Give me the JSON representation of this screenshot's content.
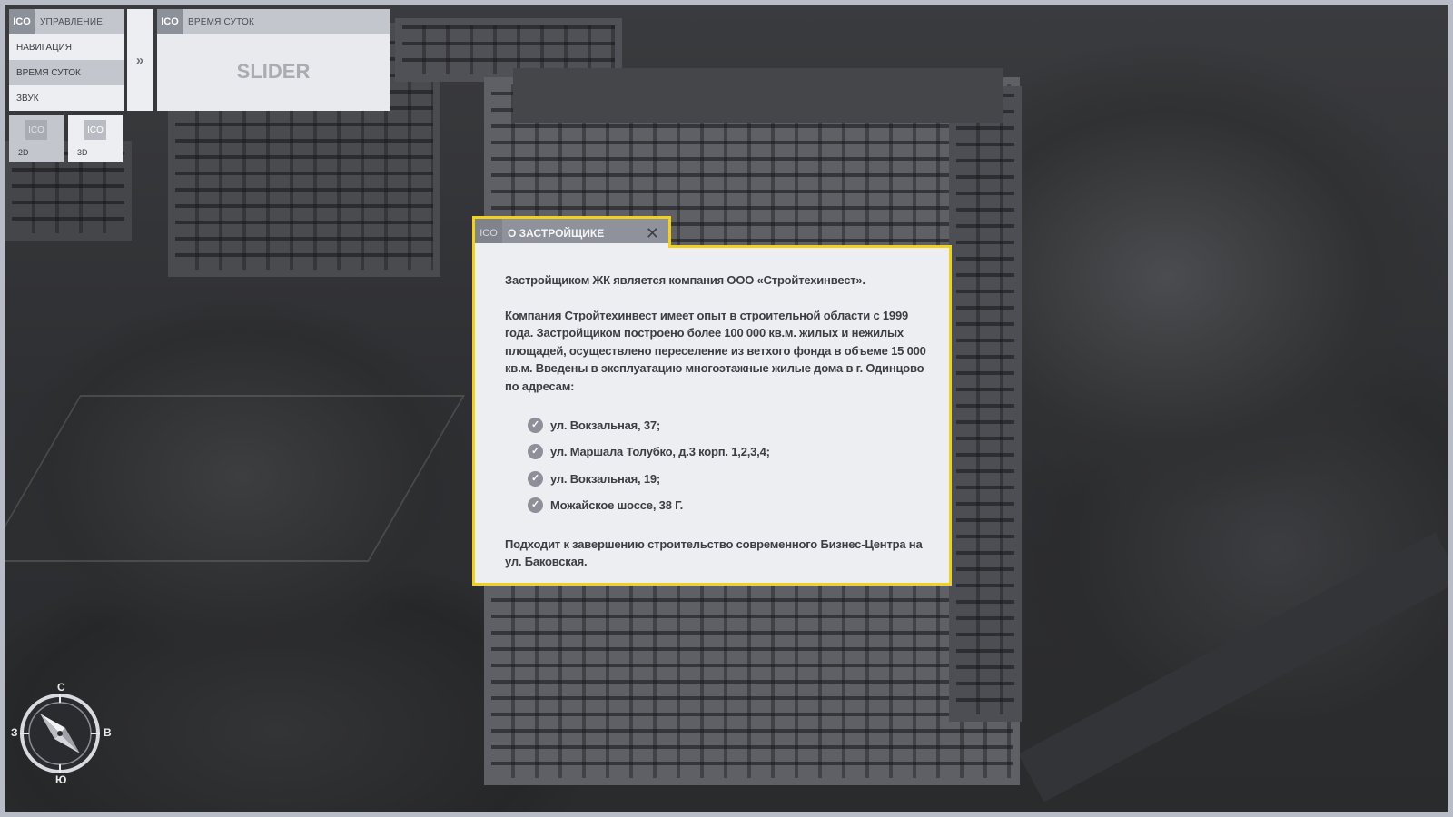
{
  "controls": {
    "head_icon": "ICO",
    "head_label": "УПРАВЛЕНИЕ",
    "items": [
      {
        "label": "НАВИГАЦИЯ",
        "active": false
      },
      {
        "label": "ВРЕМЯ СУТОК",
        "active": true
      },
      {
        "label": "ЗВУК",
        "active": false
      }
    ],
    "expand_icon": "double-chevron-right-icon"
  },
  "time_panel": {
    "head_icon": "ICO",
    "head_label": "ВРЕМЯ СУТОК",
    "slider_label": "SLIDER"
  },
  "view_buttons": [
    {
      "icon": "ICO",
      "label": "2D",
      "active": true
    },
    {
      "icon": "ICO",
      "label": "3D",
      "active": false
    }
  ],
  "modal": {
    "icon": "ICO",
    "title": "О ЗАСТРОЙЩИКЕ",
    "close_icon": "close-icon",
    "border_color": "#f0d020",
    "intro": "Застройщиком ЖК является компания ООО «Стройтехинвест».",
    "paragraph": "Компания Стройтехинвест имеет опыт в строительной области с 1999 года. Застройщиком построено более 100 000 кв.м. жилых и нежилых площадей, осуществлено переселение из ветхого фонда в объеме 15 000 кв.м. Введены в эксплуатацию многоэтажные жилые дома в г. Одинцово по адресам:",
    "addresses": [
      "ул. Вокзальная, 37;",
      "ул. Маршала Толубко, д.3 корп. 1,2,3,4;",
      "ул. Вокзальная, 19;",
      "Можайское шоссе, 38 Г."
    ],
    "closing": "Подходит к завершению строительство современного Бизнес-Центра на ул. Баковская."
  },
  "compass": {
    "north": "С",
    "south": "Ю",
    "west": "З",
    "east": "В"
  }
}
